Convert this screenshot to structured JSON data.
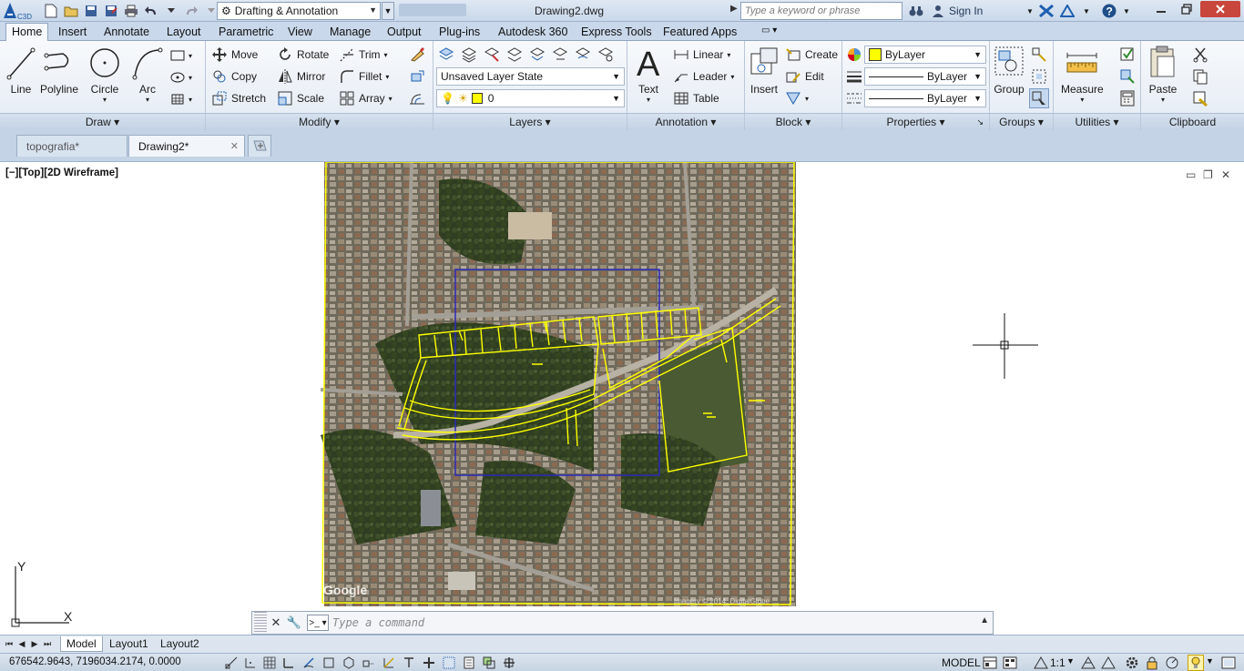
{
  "titlebar": {
    "app_badge": "C3D",
    "workspace": "Drafting & Annotation",
    "doc_title": "Drawing2.dwg",
    "search_placeholder": "Type a keyword or phrase",
    "sign_in": "Sign In",
    "help_icon": "?"
  },
  "ribbon_tabs": [
    "Home",
    "Insert",
    "Annotate",
    "Layout",
    "Parametric",
    "View",
    "Manage",
    "Output",
    "Plug-ins",
    "Autodesk 360",
    "Express Tools",
    "Featured Apps"
  ],
  "ribbon": {
    "draw": {
      "title": "Draw",
      "line": "Line",
      "polyline": "Polyline",
      "circle": "Circle",
      "arc": "Arc"
    },
    "modify": {
      "title": "Modify",
      "move": "Move",
      "rotate": "Rotate",
      "trim": "Trim",
      "copy": "Copy",
      "mirror": "Mirror",
      "fillet": "Fillet",
      "stretch": "Stretch",
      "scale": "Scale",
      "array": "Array"
    },
    "layers": {
      "title": "Layers",
      "layer_state": "Unsaved Layer State",
      "current_layer": "0",
      "layer_color": "#ffff00"
    },
    "annotation": {
      "title": "Annotation",
      "text": "Text",
      "linear": "Linear",
      "leader": "Leader",
      "table": "Table"
    },
    "block": {
      "title": "Block",
      "insert": "Insert",
      "create": "Create",
      "edit": "Edit"
    },
    "properties": {
      "title": "Properties",
      "color": "ByLayer",
      "linetype": "ByLayer",
      "lineweight": "ByLayer",
      "color_swatch": "#ffff00"
    },
    "groups": {
      "title": "Groups",
      "group": "Group"
    },
    "utilities": {
      "title": "Utilities",
      "measure": "Measure"
    },
    "clipboard": {
      "title": "Clipboard",
      "paste": "Paste"
    }
  },
  "doc_tabs": [
    "topografia*",
    "Drawing2*"
  ],
  "viewport": {
    "label": "[−][Top][2D Wireframe]",
    "google": "Google",
    "copyright": "Imagery © 2014, DigitalGlobe"
  },
  "ucs": {
    "x": "X",
    "y": "Y"
  },
  "command": {
    "placeholder": "Type a command"
  },
  "layout_tabs": [
    "Model",
    "Layout1",
    "Layout2"
  ],
  "status": {
    "coordinates": "676542.9643, 7196034.2174, 0.0000",
    "model": "MODEL",
    "scale": "1:1"
  },
  "colors": {
    "ribbon_bg": "#e8eef6",
    "parcel_lines": "#ffff00",
    "viewport_rect": "#2a2ab8",
    "accent": "#1f4f8a"
  }
}
